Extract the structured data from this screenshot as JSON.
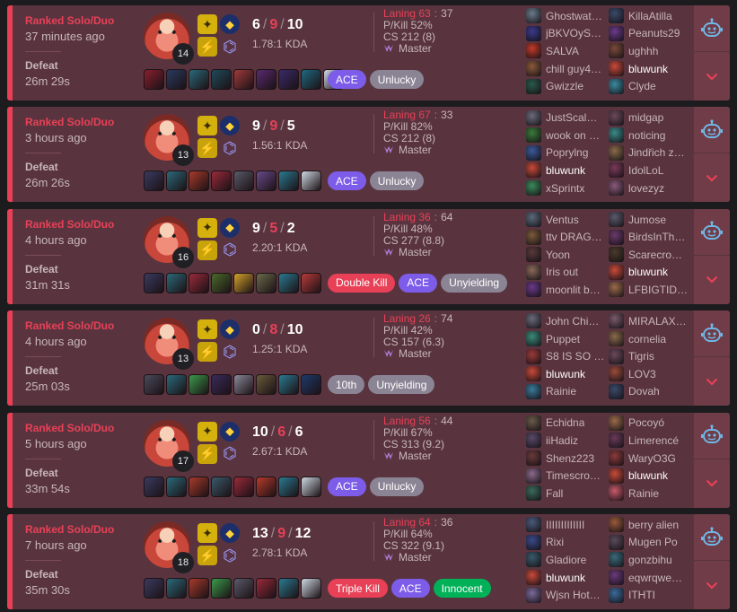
{
  "matches": [
    {
      "queue": "Ranked Solo/Duo",
      "ago": "37 minutes ago",
      "result": "Defeat",
      "length": "26m 29s",
      "level": "14",
      "kills": "6",
      "deaths": "9",
      "assists": "10",
      "ratio": "1.78:1 KDA",
      "laning_l": "Laning 63",
      "laning_r": "37",
      "pkill": "P/Kill 52%",
      "cs": "CS 212 (8)",
      "tier": "Master",
      "items": [
        "#8a1f2e",
        "#2a3a60",
        "#2a6a7a",
        "#1f4a5a",
        "#a23b3b",
        "#5a2a70",
        "#3a2a6a",
        "#1e6a80",
        "#cfd8e2"
      ],
      "tags": [
        {
          "text": "ACE",
          "kind": "ace"
        },
        {
          "text": "Unlucky",
          "kind": "grey"
        }
      ],
      "team1": [
        {
          "name": "Ghostwat…",
          "color": "#6a7a8a"
        },
        {
          "name": "jBKVOyS…",
          "color": "#3a3a8a"
        },
        {
          "name": "SALVA",
          "color": "#c23a2a"
        },
        {
          "name": "chill guy4…",
          "color": "#8a5a3a"
        },
        {
          "name": "Gwizzle",
          "color": "#2a5a4a"
        }
      ],
      "team2": [
        {
          "name": "KillaAtilla",
          "color": "#3a4a6a"
        },
        {
          "name": "Peanuts29",
          "color": "#6a3a8a"
        },
        {
          "name": "ughhh",
          "color": "#7a4a3a"
        },
        {
          "name": "bluwunk",
          "color": "#c84a3a",
          "me": true
        },
        {
          "name": "Clyde",
          "color": "#3a8aa0"
        }
      ]
    },
    {
      "queue": "Ranked Solo/Duo",
      "ago": "3 hours ago",
      "result": "Defeat",
      "length": "26m 26s",
      "level": "13",
      "kills": "9",
      "deaths": "9",
      "assists": "5",
      "ratio": "1.56:1 KDA",
      "laning_l": "Laning 67",
      "laning_r": "33",
      "pkill": "P/Kill 82%",
      "cs": "CS 212 (8)",
      "tier": "Master",
      "items": [
        "#3a3a60",
        "#2a6a7a",
        "#a83a2a",
        "#9a2a3a",
        "#5a5a6a",
        "#6a4a8a",
        "#2a7a90",
        "#cfd8e2"
      ],
      "tags": [
        {
          "text": "ACE",
          "kind": "ace"
        },
        {
          "text": "Unlucky",
          "kind": "grey"
        }
      ],
      "team1": [
        {
          "name": "JustScal…",
          "color": "#6a6a7a"
        },
        {
          "name": "wook on …",
          "color": "#3a7a3a"
        },
        {
          "name": "Poprylng",
          "color": "#3a5a9a"
        },
        {
          "name": "bluwunk",
          "color": "#c84a3a",
          "me": true
        },
        {
          "name": "xSprintx",
          "color": "#3a8a5a"
        }
      ],
      "team2": [
        {
          "name": "midgap",
          "color": "#6a4a5a"
        },
        {
          "name": "noticing",
          "color": "#3a8a8a"
        },
        {
          "name": "Jindřich z…",
          "color": "#8a6a4a"
        },
        {
          "name": "IdolLoL",
          "color": "#7a3a5a"
        },
        {
          "name": "lovezyz",
          "color": "#8a5a7a"
        }
      ]
    },
    {
      "queue": "Ranked Solo/Duo",
      "ago": "4 hours ago",
      "result": "Defeat",
      "length": "31m 31s",
      "level": "16",
      "kills": "9",
      "deaths": "5",
      "assists": "2",
      "ratio": "2.20:1 KDA",
      "laning_l": "Laning 36",
      "laning_r": "64",
      "pkill": "P/Kill 48%",
      "cs": "CS 277 (8.8)",
      "tier": "Master",
      "items": [
        "#3a3a60",
        "#2a6a7a",
        "#9a2a3a",
        "#4a6a2a",
        "#d4a22a",
        "#6a6a4a",
        "#2a7a90",
        "#b83a3a"
      ],
      "tags": [
        {
          "text": "Double Kill",
          "kind": "red"
        },
        {
          "text": "ACE",
          "kind": "ace"
        },
        {
          "text": "Unyielding",
          "kind": "grey"
        }
      ],
      "team1": [
        {
          "name": "Ventus",
          "color": "#5a6a7a"
        },
        {
          "name": "ttv DRAG…",
          "color": "#7a5a3a"
        },
        {
          "name": "Yoon",
          "color": "#5a3a3a"
        },
        {
          "name": "Iris out",
          "color": "#8a6a5a"
        },
        {
          "name": "moonlit b…",
          "color": "#6a3a8a"
        }
      ],
      "team2": [
        {
          "name": "Jumose",
          "color": "#5a5a6a"
        },
        {
          "name": "BirdsInTh…",
          "color": "#6a3a6a"
        },
        {
          "name": "Scarecro…",
          "color": "#4a3a2a"
        },
        {
          "name": "bluwunk",
          "color": "#c84a3a",
          "me": true
        },
        {
          "name": "LFBIGTID…",
          "color": "#9a6a4a"
        }
      ]
    },
    {
      "queue": "Ranked Solo/Duo",
      "ago": "4 hours ago",
      "result": "Defeat",
      "length": "25m 03s",
      "level": "13",
      "kills": "0",
      "deaths": "8",
      "assists": "10",
      "ratio": "1.25:1 KDA",
      "laning_l": "Laning 26",
      "laning_r": "74",
      "pkill": "P/Kill 42%",
      "cs": "CS 157 (6.3)",
      "tier": "Master",
      "items": [
        "#4a4a5a",
        "#2a6a7a",
        "#3a9a4a",
        "#3a2a5a",
        "#8a8a9a",
        "#6a5a3a",
        "#2a7a90",
        "#1e3a6a"
      ],
      "tags": [
        {
          "text": "10th",
          "kind": "grey"
        },
        {
          "text": "Unyielding",
          "kind": "grey"
        }
      ],
      "team1": [
        {
          "name": "John Chi…",
          "color": "#6a6a7a"
        },
        {
          "name": "Puppet",
          "color": "#3a8a7a"
        },
        {
          "name": "S8 IS SO …",
          "color": "#9a3a3a"
        },
        {
          "name": "bluwunk",
          "color": "#c84a3a",
          "me": true
        },
        {
          "name": "Rainie",
          "color": "#3a7a9a"
        }
      ],
      "team2": [
        {
          "name": "MIRALAX…",
          "color": "#7a5a6a"
        },
        {
          "name": "cornelia",
          "color": "#8a6a4a"
        },
        {
          "name": "Tigris",
          "color": "#6a4a5a"
        },
        {
          "name": "LOV3",
          "color": "#9a4a3a"
        },
        {
          "name": "Dovah",
          "color": "#3a4a6a"
        }
      ]
    },
    {
      "queue": "Ranked Solo/Duo",
      "ago": "5 hours ago",
      "result": "Defeat",
      "length": "33m 54s",
      "level": "17",
      "kills": "10",
      "deaths": "6",
      "assists": "6",
      "ratio": "2.67:1 KDA",
      "laning_l": "Laning 56",
      "laning_r": "44",
      "pkill": "P/Kill 67%",
      "cs": "CS 313 (9.2)",
      "tier": "Master",
      "items": [
        "#3a3a60",
        "#2a6a7a",
        "#a83a2a",
        "#3a5a6a",
        "#9a2a3a",
        "#b83a2a",
        "#2a7a90",
        "#cfd8e2"
      ],
      "tags": [
        {
          "text": "ACE",
          "kind": "ace"
        },
        {
          "text": "Unlucky",
          "kind": "grey"
        }
      ],
      "team1": [
        {
          "name": "Echidna",
          "color": "#6a5a4a"
        },
        {
          "name": "iiHadiz",
          "color": "#5a4a6a"
        },
        {
          "name": "Shenz223",
          "color": "#6a3a3a"
        },
        {
          "name": "Timescro…",
          "color": "#8a6a8a"
        },
        {
          "name": "Fall",
          "color": "#3a6a5a"
        }
      ],
      "team2": [
        {
          "name": "Pocoyó",
          "color": "#9a6a4a"
        },
        {
          "name": "Limerencé",
          "color": "#6a3a5a"
        },
        {
          "name": "WaryO3G",
          "color": "#8a3a3a"
        },
        {
          "name": "bluwunk",
          "color": "#c84a3a",
          "me": true
        },
        {
          "name": "Rainie",
          "color": "#c85a6a"
        }
      ]
    },
    {
      "queue": "Ranked Solo/Duo",
      "ago": "7 hours ago",
      "result": "Defeat",
      "length": "35m 30s",
      "level": "18",
      "kills": "13",
      "deaths": "9",
      "assists": "12",
      "ratio": "2.78:1 KDA",
      "laning_l": "Laning 64",
      "laning_r": "36",
      "pkill": "P/Kill 64%",
      "cs": "CS 322 (9.1)",
      "tier": "Master",
      "items": [
        "#3a3a60",
        "#2a6a7a",
        "#a83a2a",
        "#3a9a4a",
        "#5a5a6a",
        "#9a2a3a",
        "#2a7a90",
        "#cfd8e2"
      ],
      "tags": [
        {
          "text": "Triple Kill",
          "kind": "red"
        },
        {
          "text": "ACE",
          "kind": "ace"
        },
        {
          "text": "Innocent",
          "kind": "green"
        }
      ],
      "team1": [
        {
          "name": "IIIIIIIIIIIII",
          "color": "#4a5a7a"
        },
        {
          "name": "Rixi",
          "color": "#3a4a8a"
        },
        {
          "name": "Gladiore",
          "color": "#3a5a6a"
        },
        {
          "name": "bluwunk",
          "color": "#c84a3a",
          "me": true
        },
        {
          "name": "Wjsn Hot…",
          "color": "#7a6a9a"
        }
      ],
      "team2": [
        {
          "name": "berry alien",
          "color": "#9a5a3a"
        },
        {
          "name": "Mugen Po",
          "color": "#5a4a5a"
        },
        {
          "name": "gonzbihu",
          "color": "#3a6a7a"
        },
        {
          "name": "eqwrqwe…",
          "color": "#6a3a7a"
        },
        {
          "name": "ITHTI",
          "color": "#3a6a9a"
        }
      ]
    }
  ]
}
